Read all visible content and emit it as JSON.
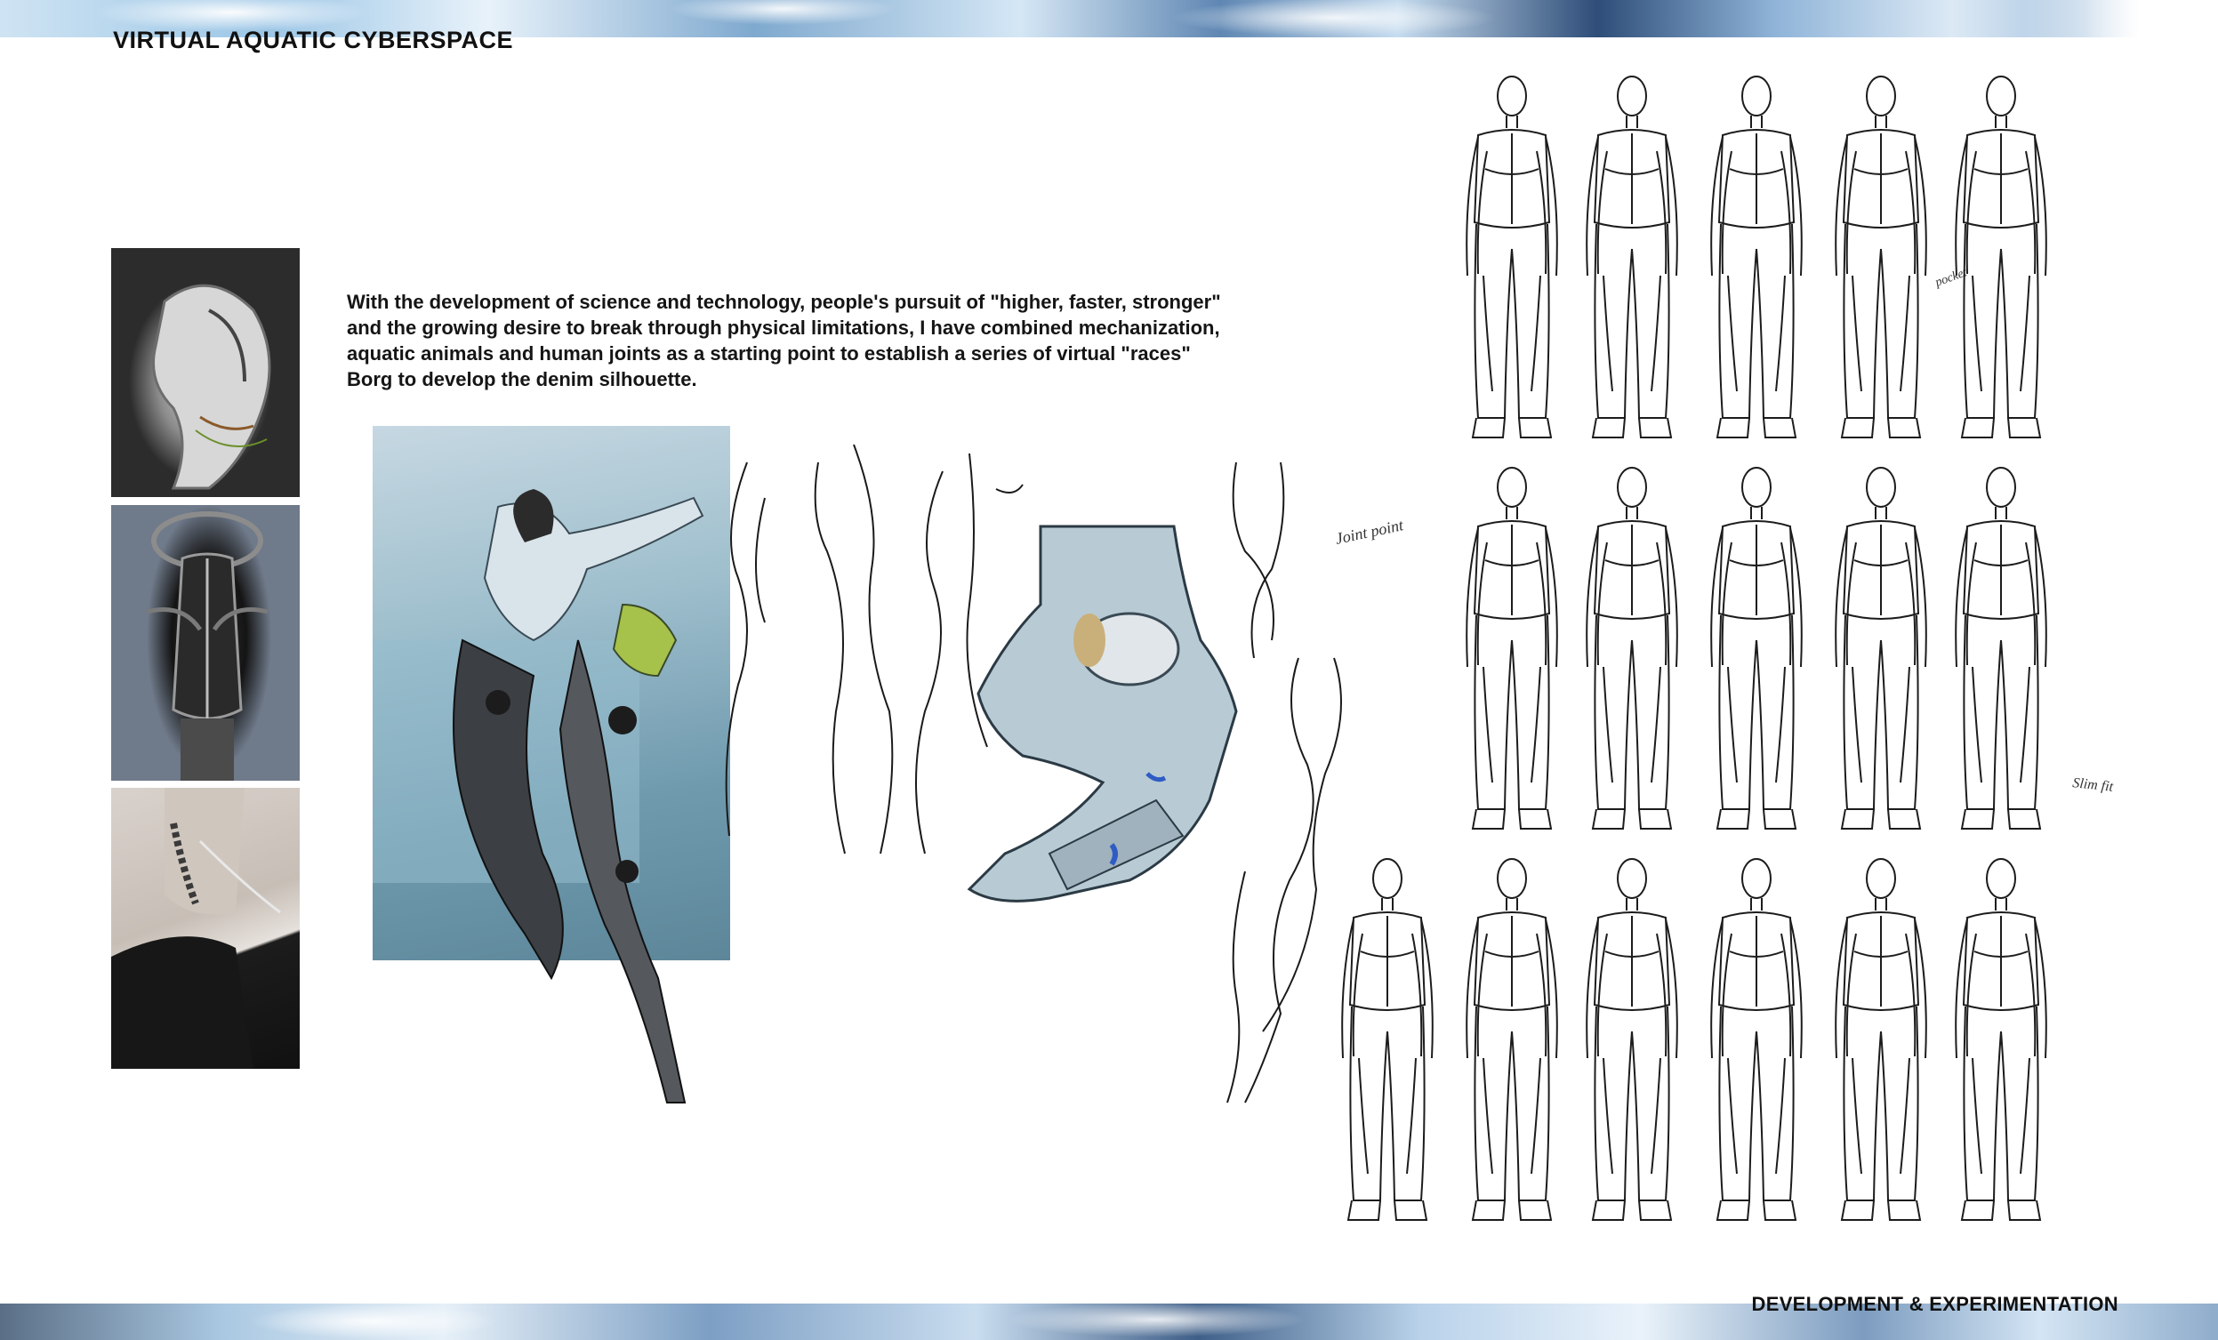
{
  "header": {
    "title": "VIRTUAL AQUATIC CYBERSPACE"
  },
  "description": {
    "lines": [
      "With the development of science and technology, people's pursuit of \"higher, faster, stronger\"",
      "and the growing desire to break through physical limitations, I have combined mechanization,",
      "aquatic animals and human joints as a starting point to establish a series of virtual \"races\"",
      "Borg to develop the denim silhouette."
    ]
  },
  "footer": {
    "section_label": "DEVELOPMENT & EXPERIMENTATION"
  },
  "annotations": {
    "joint_note": "Joint point",
    "side_note": "pocket",
    "corner_note": "Slim fit"
  },
  "colors": {
    "text": "#111111",
    "band_light": "#cfe4f3",
    "band_dark": "#2e4d78",
    "collage_teal": "#6f9aae"
  }
}
